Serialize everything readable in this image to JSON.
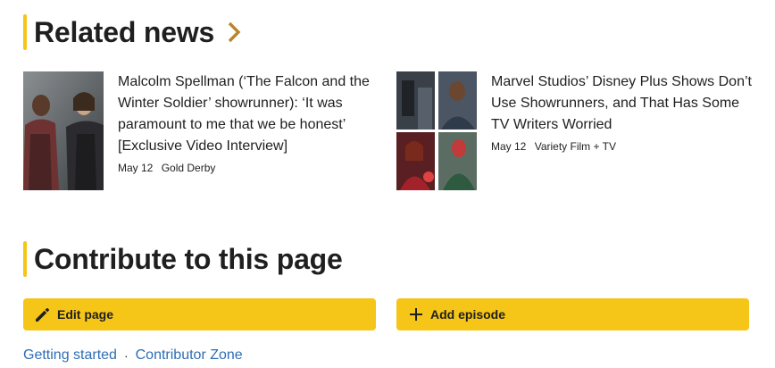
{
  "related_news": {
    "heading": "Related news",
    "items": [
      {
        "title": "Malcolm Spellman (‘The Falcon and the Winter Soldier’ showrunner): ‘It was paramount to me that we be honest’ [Exclusive Video Interview]",
        "date": "May 12",
        "source": "Gold Derby"
      },
      {
        "title": "Marvel Studios’ Disney Plus Shows Don’t Use Showrunners, and That Has Some TV Writers Worried",
        "date": "May 12",
        "source": "Variety Film + TV"
      }
    ]
  },
  "contribute": {
    "heading": "Contribute to this page",
    "edit_label": "Edit page",
    "add_label": "Add episode"
  },
  "footer": {
    "getting_started": "Getting started",
    "separator": "·",
    "contributor_zone": "Contributor Zone"
  },
  "colors": {
    "accent": "#f5c518",
    "link": "#2f6db5",
    "chevron": "#b8862b"
  },
  "icons": {
    "chevron": "chevron-right-icon",
    "edit": "pencil-icon",
    "add": "plus-icon"
  }
}
